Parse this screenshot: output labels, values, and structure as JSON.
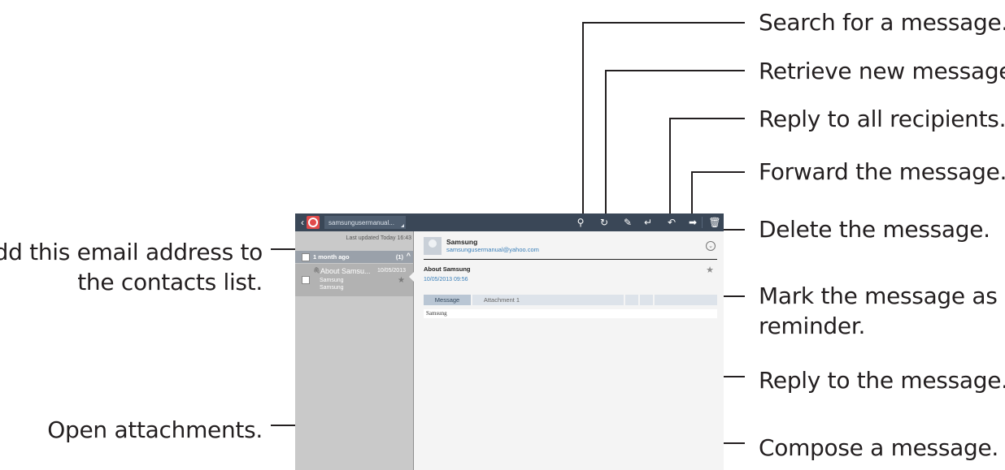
{
  "callouts": {
    "search": "Search for a message.",
    "retrieve": "Retrieve new messages.",
    "reply_all": "Reply to all recipients.",
    "forward": "Forward the message.",
    "delete": "Delete the message.",
    "reminder_line1": "Mark the message as a",
    "reminder_line2": "reminder.",
    "reply": "Reply to the message.",
    "compose": "Compose a message.",
    "add_contact_line1": "Add this email address to",
    "add_contact_line2": "the contacts list.",
    "attachments": "Open attachments."
  },
  "action_bar": {
    "back_icon": "chevron-left-icon",
    "app_icon": "email-app-icon",
    "account": "samsungusermanual...",
    "icons": [
      "search-icon",
      "refresh-icon",
      "compose-icon",
      "reply-icon",
      "reply-all-icon",
      "forward-icon",
      "delete-icon"
    ],
    "search_glyph": "⚲",
    "refresh_glyph": "↻",
    "compose_glyph": "✎",
    "reply_glyph": "↵",
    "replyall_glyph": "↶",
    "forward_glyph": "➡",
    "delete_glyph": "🗑"
  },
  "message_list": {
    "last_updated": "Last updated  Today 16:43",
    "group_label": "1 month ago",
    "group_count": "(1)",
    "collapse_glyph": "^",
    "item": {
      "attach_glyph": "🖇",
      "subject": "About Samsu...",
      "date": "10/05/2013",
      "sender": "Samsung",
      "preview": "Samsung",
      "star_glyph": "★"
    }
  },
  "reading_pane": {
    "sender_name": "Samsung",
    "sender_email": "samsungusermanual@yahoo.com",
    "expand_glyph": "⌄",
    "subject": "About Samsung",
    "sent_time": "10/05/2013  09:56",
    "star_glyph": "★",
    "tabs": [
      "Message",
      "Attachment 1"
    ],
    "body": "Samsung"
  },
  "colors": {
    "action_bar": "#3a4757",
    "list_pane": "#c9c9c9",
    "selected_item": "#b2b2b2",
    "link_blue": "#3a7fb9",
    "callout_line": "#231f20"
  }
}
